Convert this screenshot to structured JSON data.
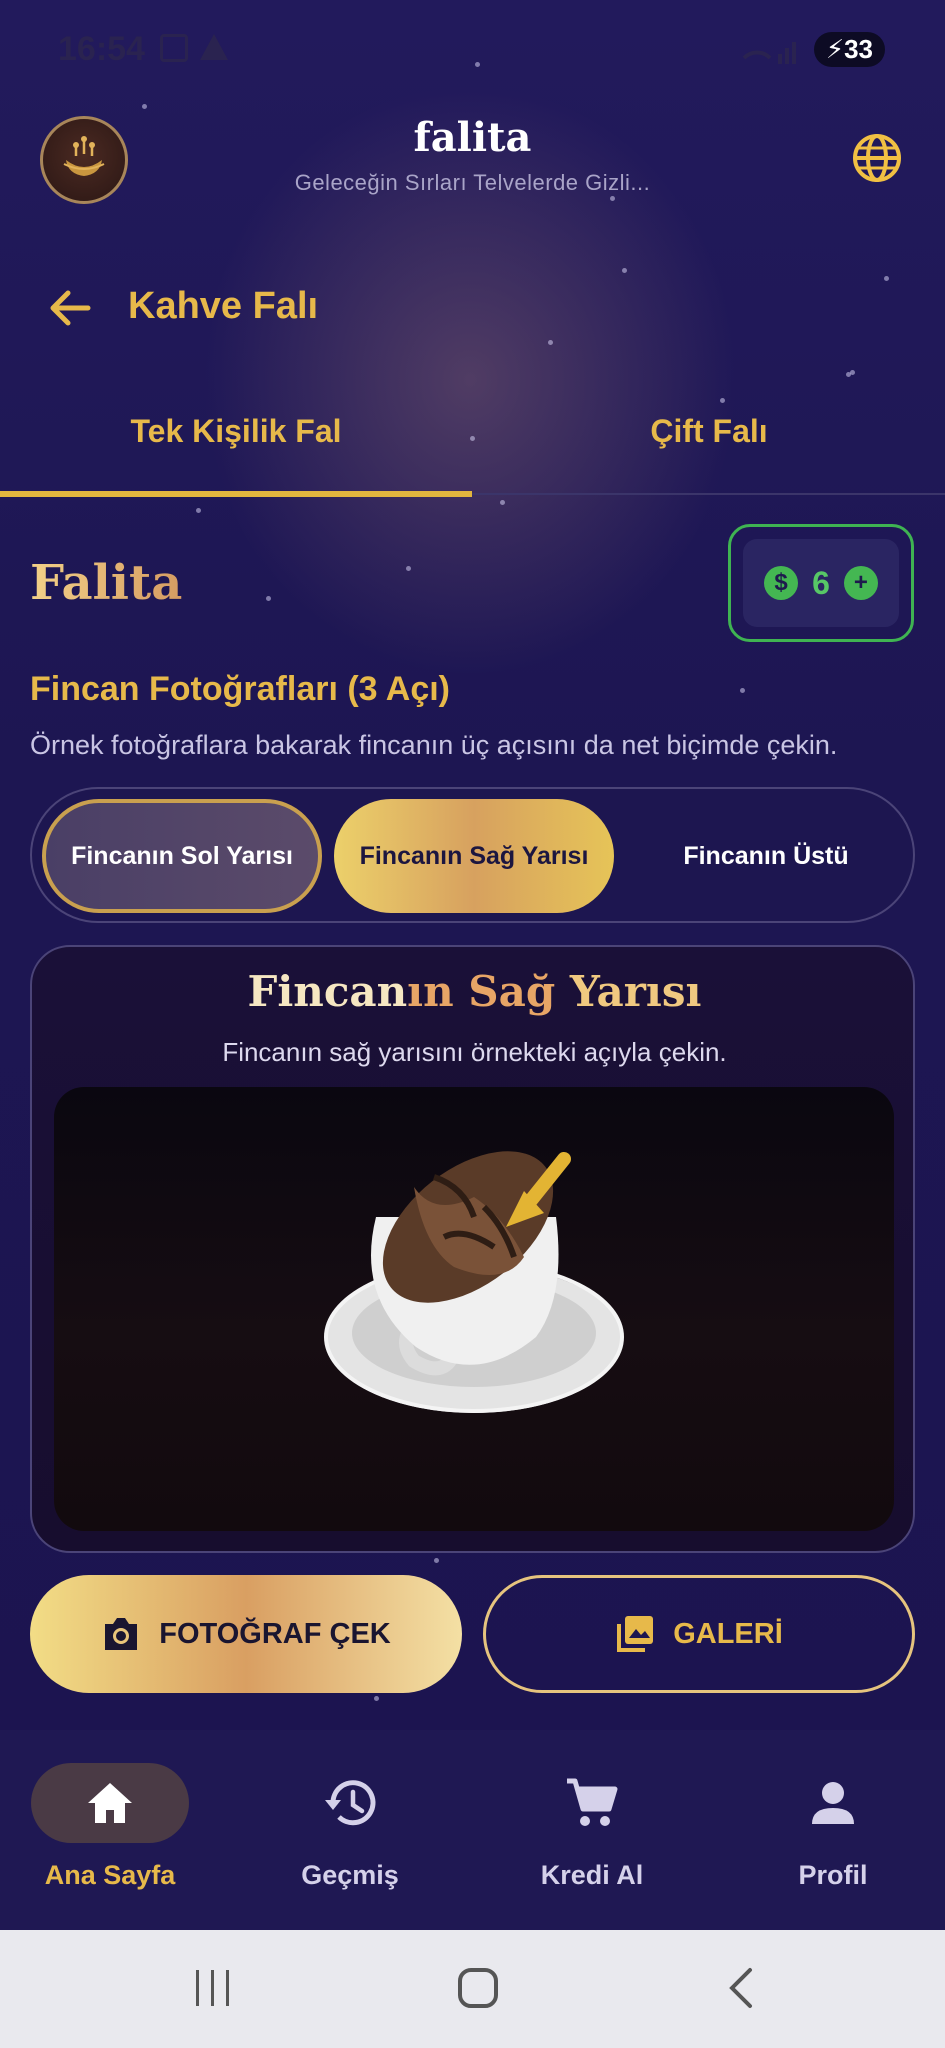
{
  "status_bar": {
    "time": "16:54",
    "battery": "33"
  },
  "app": {
    "title": "falita",
    "subtitle": "Geleceğin Sırları Telvelerde Gizli..."
  },
  "page": {
    "title": "Kahve Falı"
  },
  "tabs": [
    {
      "label": "Tek Kişilik Fal",
      "active": true
    },
    {
      "label": "Çift Falı",
      "active": false
    }
  ],
  "brand": "Falita",
  "credits": {
    "value": "6"
  },
  "section": {
    "title": "Fincan Fotoğrafları (3 Açı)",
    "description": "Örnek fotoğraflara bakarak fincanın üç açısını da net biçimde çekin."
  },
  "angles": [
    {
      "label": "Fincanın Sol Yarısı",
      "state": "completed"
    },
    {
      "label": "Fincanın Sağ Yarısı",
      "state": "selected"
    },
    {
      "label": "Fincanın Üstü",
      "state": "pending"
    }
  ],
  "card": {
    "title_part1": "Fincan",
    "title_part2": "ın Sağ",
    "title_part3": " Yarısı",
    "subtitle": "Fincanın sağ yarısını örnekteki açıyla çekin."
  },
  "actions": {
    "camera_label": "FOTOĞRAF ÇEK",
    "gallery_label": "GALERİ"
  },
  "nav": [
    {
      "label": "Ana Sayfa",
      "icon": "home-icon",
      "active": true
    },
    {
      "label": "Geçmiş",
      "icon": "history-icon",
      "active": false
    },
    {
      "label": "Kredi Al",
      "icon": "cart-icon",
      "active": false
    },
    {
      "label": "Profil",
      "icon": "person-icon",
      "active": false
    }
  ],
  "colors": {
    "gold": "#e7b94a",
    "green": "#44b752",
    "background": "#1b1550"
  }
}
